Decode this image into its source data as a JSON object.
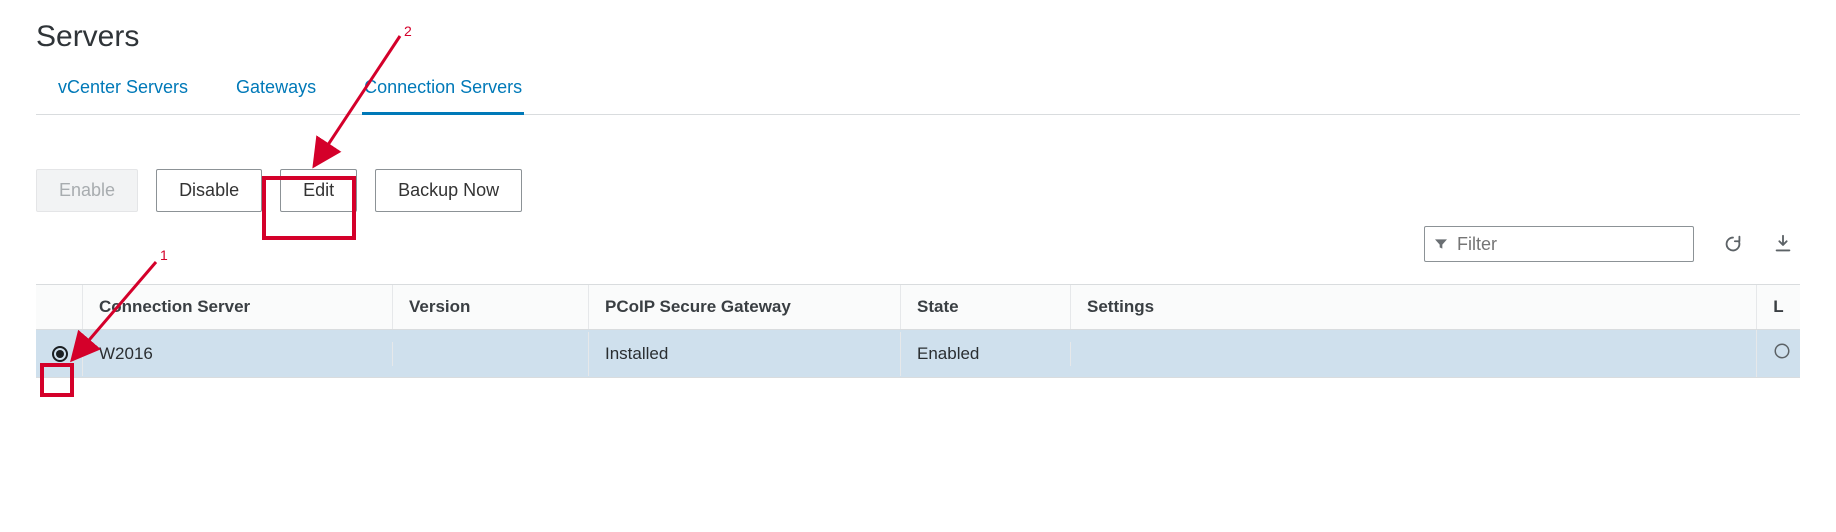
{
  "page_title": "Servers",
  "tabs": [
    {
      "label": "vCenter Servers",
      "active": false
    },
    {
      "label": "Gateways",
      "active": false
    },
    {
      "label": "Connection Servers",
      "active": true
    }
  ],
  "toolbar": {
    "enable_label": "Enable",
    "disable_label": "Disable",
    "edit_label": "Edit",
    "backup_label": "Backup Now"
  },
  "filter": {
    "placeholder": "Filter"
  },
  "table": {
    "headers": {
      "connection_server": "Connection Server",
      "version": "Version",
      "pcoip": "PCoIP Secure Gateway",
      "state": "State",
      "settings": "Settings",
      "last": "L"
    },
    "rows": [
      {
        "selected": true,
        "connection_server": "W2016",
        "version": "",
        "pcoip": "Installed",
        "state": "Enabled",
        "settings": ""
      }
    ]
  },
  "annotations": {
    "step1": "1",
    "step2": "2"
  }
}
